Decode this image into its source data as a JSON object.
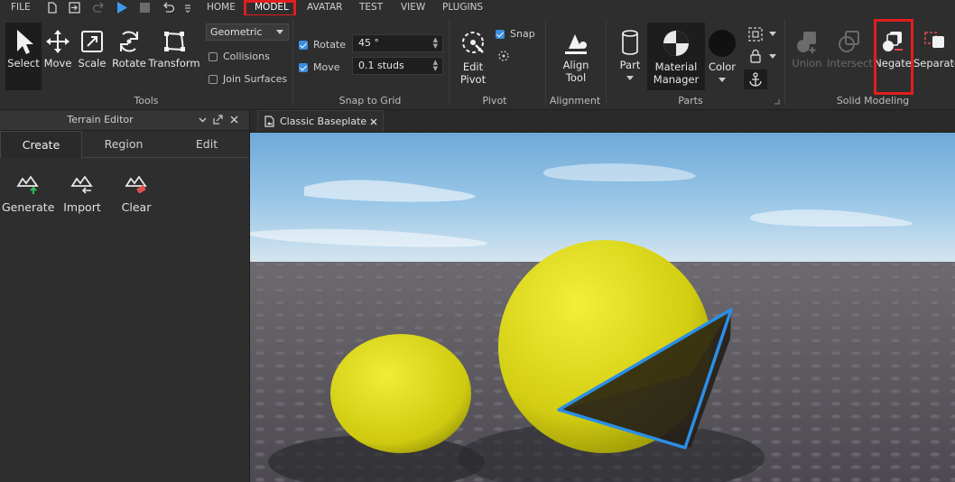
{
  "menu": {
    "file": "FILE",
    "tabs": [
      "HOME",
      "MODEL",
      "AVATAR",
      "TEST",
      "VIEW",
      "PLUGINS"
    ],
    "selected": "MODEL"
  },
  "tools": {
    "select": "Select",
    "move": "Move",
    "scale": "Scale",
    "rotate": "Rotate",
    "transform": "Transform",
    "mode": "Geometric",
    "collisions": "Collisions",
    "join_surfaces": "Join Surfaces",
    "title": "Tools"
  },
  "snap": {
    "rotate_label": "Rotate",
    "rotate_value": "45 °",
    "move_label": "Move",
    "move_value": "0.1 studs",
    "title": "Snap to Grid"
  },
  "pivot": {
    "edit_line1": "Edit",
    "edit_line2": "Pivot",
    "snap": "Snap",
    "title": "Pivot"
  },
  "alignment": {
    "line1": "Align",
    "line2": "Tool",
    "title": "Alignment"
  },
  "parts": {
    "part": "Part",
    "material_line1": "Material",
    "material_line2": "Manager",
    "color": "Color",
    "title": "Parts"
  },
  "solid": {
    "union": "Union",
    "intersect": "Intersect",
    "negate": "Negate",
    "separate": "Separate",
    "title": "Solid Modeling"
  },
  "terrain": {
    "title": "Terrain Editor",
    "tabs": [
      "Create",
      "Region",
      "Edit"
    ],
    "tools": [
      "Generate",
      "Import",
      "Clear"
    ]
  },
  "doc": {
    "tab_title": "Classic Baseplate"
  },
  "colors": {
    "accent": "#3b8de0",
    "highlight": "#e01e1e",
    "sphere": "#d6d216",
    "sky": "#7fb6de",
    "ground": "#56535a"
  }
}
